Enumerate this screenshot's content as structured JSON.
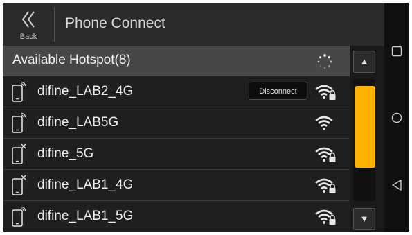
{
  "header": {
    "back_label": "Back",
    "title": "Phone Connect"
  },
  "hotspot": {
    "heading": "Available Hotspot(8)",
    "disconnect_label": "Disconnect"
  },
  "networks": [
    {
      "name": "difine_LAB2_4G",
      "connected": true,
      "secured": true,
      "phone_state": "signal"
    },
    {
      "name": "difine_LAB5G",
      "connected": false,
      "secured": false,
      "phone_state": "signal"
    },
    {
      "name": "difine_5G",
      "connected": false,
      "secured": true,
      "phone_state": "x"
    },
    {
      "name": "difine_LAB1_4G",
      "connected": false,
      "secured": true,
      "phone_state": "x"
    },
    {
      "name": "difine_LAB1_5G",
      "connected": false,
      "secured": true,
      "phone_state": "signal"
    }
  ],
  "scroll": {
    "up": "▲",
    "down": "▼"
  },
  "colors": {
    "accent": "#ffb300",
    "background": "#1f1f1f",
    "header": "#2a2a2a",
    "subheader": "#474747"
  },
  "icons": {
    "back": "double-chevron-left-icon",
    "spinner": "loading-spinner-icon",
    "wifi": "wifi-icon",
    "lock": "lock-icon",
    "phone": "phone-icon",
    "square": "square-icon",
    "circle": "circle-icon",
    "triangle": "triangle-back-icon"
  }
}
